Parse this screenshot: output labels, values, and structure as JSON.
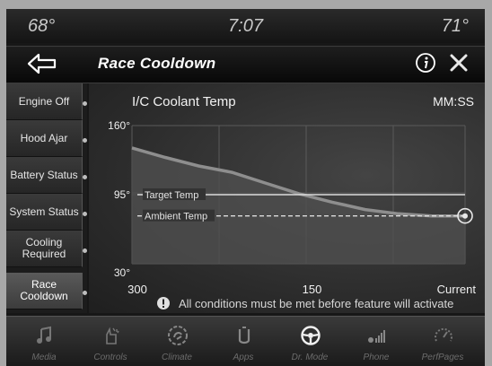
{
  "status": {
    "left_temp": "68°",
    "time": "7:07",
    "right_temp": "71°"
  },
  "header": {
    "title": "Race Cooldown",
    "back_icon": "back-arrow-icon",
    "info_icon": "info-icon",
    "close_icon": "close-icon"
  },
  "sidebar": {
    "items": [
      {
        "label": "Engine Off"
      },
      {
        "label": "Hood Ajar"
      },
      {
        "label": "Battery Status"
      },
      {
        "label": "System Status"
      },
      {
        "label": "Cooling Required"
      },
      {
        "label": "Race Cooldown",
        "active": true
      }
    ]
  },
  "main": {
    "chart_title": "I/C Coolant Temp",
    "time_unit": "MM:SS",
    "warning": "All conditions must be met before feature will activate"
  },
  "chart_data": {
    "type": "line",
    "title": "I/C Coolant Temp",
    "xlabel": "MM:SS",
    "ylabel": "",
    "x_ticks": [
      "300",
      "150",
      "Current"
    ],
    "y_ticks": [
      "160°",
      "95°",
      "30°"
    ],
    "ylim": [
      30,
      160
    ],
    "series": [
      {
        "name": "",
        "x": [
          300,
          270,
          240,
          210,
          180,
          150,
          120,
          90,
          60,
          30,
          0
        ],
        "values": [
          139,
          130,
          122,
          116,
          106,
          96,
          88,
          81,
          77,
          75,
          75
        ]
      }
    ],
    "reference_lines": [
      {
        "label": "Target Temp",
        "value": 95
      },
      {
        "label": "Ambient Temp",
        "value": 75
      }
    ],
    "grid": true
  },
  "nav": {
    "items": [
      {
        "label": "Media",
        "icon": "music-note-icon"
      },
      {
        "label": "Controls",
        "icon": "controls-hand-icon"
      },
      {
        "label": "Climate",
        "icon": "climate-fan-icon"
      },
      {
        "label": "Apps",
        "icon": "apps-icon"
      },
      {
        "label": "Dr. Mode",
        "icon": "steering-wheel-icon"
      },
      {
        "label": "Phone",
        "icon": "phone-signal-icon"
      },
      {
        "label": "PerfPages",
        "icon": "gauge-icon"
      }
    ]
  },
  "colors": {
    "accent": "#ffffff",
    "curve": "#8e8e8e",
    "fill": "#4f4f4f"
  }
}
